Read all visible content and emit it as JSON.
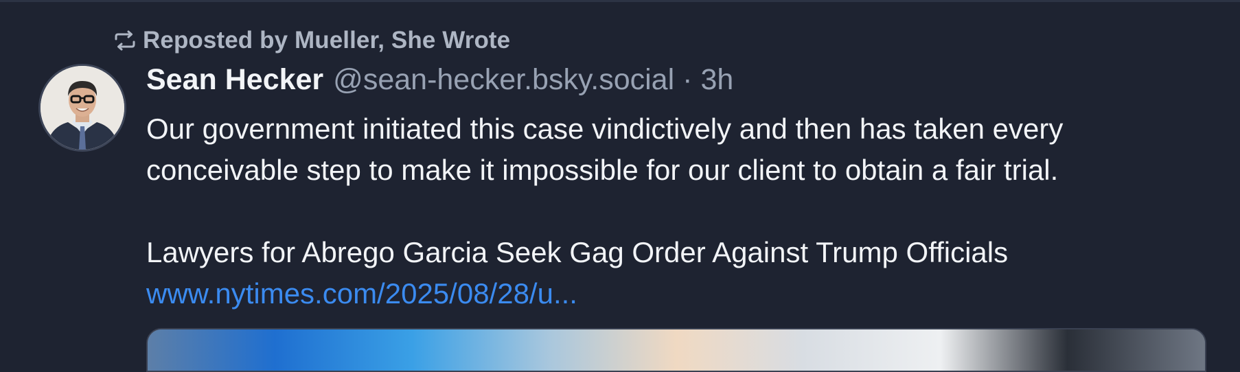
{
  "repost": {
    "icon": "repost-icon",
    "text": "Reposted by Mueller, She Wrote"
  },
  "author": {
    "name": "Sean Hecker",
    "handle": "@sean-hecker.bsky.social",
    "separator": "·",
    "time": "3h",
    "avatar_icon": "avatar-photo"
  },
  "post": {
    "line1": "Our government initiated this case vindictively and then has taken every",
    "line2": "conceivable step to make it impossible for our client to obtain a fair trial.",
    "line3": "Lawyers for Abrego Garcia Seek Gag Order Against Trump Officials",
    "link_text": "www.nytimes.com/2025/08/28/u..."
  },
  "colors": {
    "background": "#1e2331",
    "primary_text": "#f2f4f7",
    "secondary_text": "#98a2b3",
    "link": "#3b8bf0"
  }
}
